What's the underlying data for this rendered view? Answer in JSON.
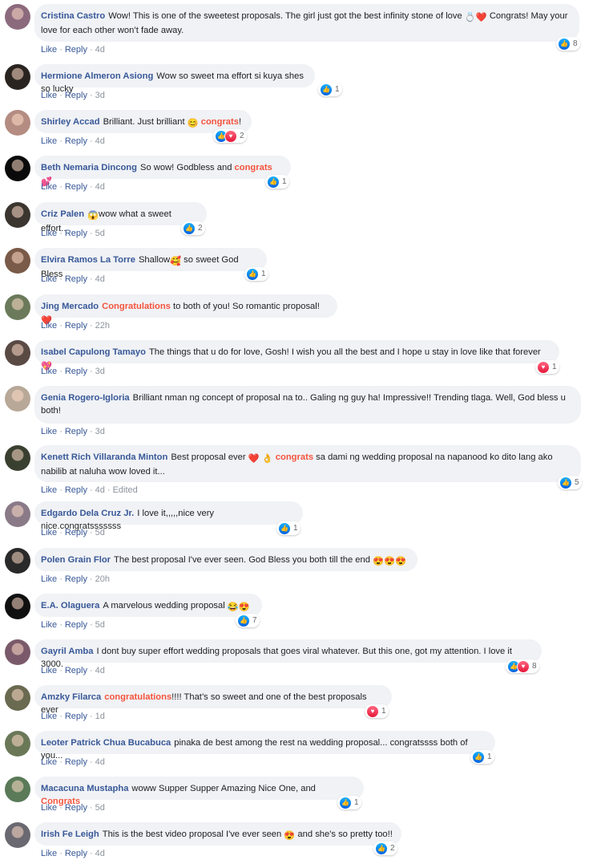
{
  "ui": {
    "like": "Like",
    "reply": "Reply",
    "sep": "·"
  },
  "comments": [
    {
      "name": "Cristina Castro",
      "parts": [
        [
          "t",
          "Wow! This is one of the sweetest proposals. The girl just got the best infinity stone of love "
        ],
        [
          "e",
          "💍"
        ],
        [
          "e",
          "❤️"
        ],
        [
          "t",
          " Congrats! May your love for each other won’t fade away."
        ]
      ],
      "time": "4d",
      "reactions": [
        "like"
      ],
      "count": "8"
    },
    {
      "name": "Hermione Almeron Asiong",
      "parts": [
        [
          "t",
          "Wow so sweet ma effort si kuya shes so lucky"
        ]
      ],
      "time": "3d",
      "reactions": [
        "like"
      ],
      "count": "1"
    },
    {
      "name": "Shirley Accad",
      "parts": [
        [
          "t",
          "Brilliant. Just brilliant "
        ],
        [
          "e",
          "😊"
        ],
        [
          "t",
          " "
        ],
        [
          "h",
          "congrats"
        ],
        [
          "t",
          "!"
        ]
      ],
      "time": "4d",
      "reactions": [
        "like",
        "love"
      ],
      "count": "2"
    },
    {
      "name": "Beth Nemaria Dincong",
      "parts": [
        [
          "t",
          "So wow! Godbless and "
        ],
        [
          "h",
          "congrats"
        ],
        [
          "e",
          "💕"
        ]
      ],
      "time": "4d",
      "reactions": [
        "like"
      ],
      "count": "1"
    },
    {
      "name": "Criz Palen",
      "parts": [
        [
          "e",
          "😱"
        ],
        [
          "t",
          "wow what a sweet effort.."
        ]
      ],
      "time": "5d",
      "reactions": [
        "like"
      ],
      "count": "2"
    },
    {
      "name": "Elvira Ramos La Torre",
      "parts": [
        [
          "t",
          "Shallow"
        ],
        [
          "e",
          "🥰"
        ],
        [
          "t",
          " so sweet God Bless"
        ]
      ],
      "time": "4d",
      "reactions": [
        "like"
      ],
      "count": "1"
    },
    {
      "name": "Jing Mercado",
      "parts": [
        [
          "h",
          "Congratulations"
        ],
        [
          "t",
          " to both of you! So romantic proposal!"
        ],
        [
          "e",
          "❤️"
        ]
      ],
      "time": "22h",
      "reactions": [],
      "count": ""
    },
    {
      "name": "Isabel Capulong Tamayo",
      "parts": [
        [
          "t",
          "The things that u do for love, Gosh! I wish you all the best and I hope u stay in love like that forever "
        ],
        [
          "e",
          "💖"
        ]
      ],
      "time": "3d",
      "reactions": [
        "love"
      ],
      "count": "1"
    },
    {
      "name": "Genia Rogero-Igloria",
      "parts": [
        [
          "t",
          "Brilliant nman ng concept of proposal na to.. Galing ng guy ha! Impressive!! Trending tlaga. Well, God bless u both!"
        ]
      ],
      "time": "3d",
      "reactions": [],
      "count": ""
    },
    {
      "name": "Kenett Rich Villaranda Minton",
      "parts": [
        [
          "t",
          "Best proposal ever "
        ],
        [
          "e",
          "❤️"
        ],
        [
          "t",
          " "
        ],
        [
          "e",
          "👌"
        ],
        [
          "t",
          " "
        ],
        [
          "h",
          "congrats"
        ],
        [
          "t",
          " sa dami ng wedding proposal na napanood ko dito lang ako nabilib at naluha wow loved it..."
        ]
      ],
      "time": "4d",
      "edited": "Edited",
      "reactions": [
        "like"
      ],
      "count": "5"
    },
    {
      "name": "Edgardo Dela Cruz Jr.",
      "parts": [
        [
          "t",
          "I love it,,,,,nice very nice.congratsssssss"
        ]
      ],
      "time": "5d",
      "reactions": [
        "like"
      ],
      "count": "1"
    },
    {
      "name": "Polen Grain Flor",
      "parts": [
        [
          "t",
          "The best proposal I've ever seen. God Bless you both till the end "
        ],
        [
          "e",
          "😍😍😍"
        ]
      ],
      "time": "20h",
      "reactions": [],
      "count": ""
    },
    {
      "name": "E.A. Olaguera",
      "parts": [
        [
          "t",
          "A marvelous wedding proposal "
        ],
        [
          "e",
          "😂😍"
        ]
      ],
      "time": "5d",
      "reactions": [
        "like"
      ],
      "count": "7"
    },
    {
      "name": "Gayril Amba",
      "parts": [
        [
          "t",
          "I dont buy super effort wedding proposals that goes viral whatever. But this one, got my attention. I love it 3000."
        ]
      ],
      "time": "4d",
      "reactions": [
        "like",
        "love"
      ],
      "count": "8"
    },
    {
      "name": "Amzky Filarca",
      "parts": [
        [
          "h",
          "congratulations"
        ],
        [
          "t",
          "!!!! That’s so sweet and one of the best proposals ever"
        ]
      ],
      "time": "1d",
      "reactions": [
        "love"
      ],
      "count": "1"
    },
    {
      "name": "Leoter Patrick Chua Bucabuca",
      "parts": [
        [
          "t",
          "pinaka de best among the rest na wedding proposal... congratssss both of you..."
        ]
      ],
      "time": "4d",
      "reactions": [
        "like"
      ],
      "count": "1"
    },
    {
      "name": "Macacuna Mustapha",
      "parts": [
        [
          "t",
          "woww Supper Supper Amazing Nice One, and "
        ],
        [
          "h",
          "Congrats"
        ]
      ],
      "time": "5d",
      "reactions": [
        "like"
      ],
      "count": "1"
    },
    {
      "name": "Irish Fe Leigh",
      "parts": [
        [
          "t",
          "This is the best video proposal I've ever seen "
        ],
        [
          "e",
          "😍"
        ],
        [
          "t",
          " and she's so pretty too!!"
        ]
      ],
      "time": "4d",
      "reactions": [
        "like"
      ],
      "count": "2"
    }
  ]
}
